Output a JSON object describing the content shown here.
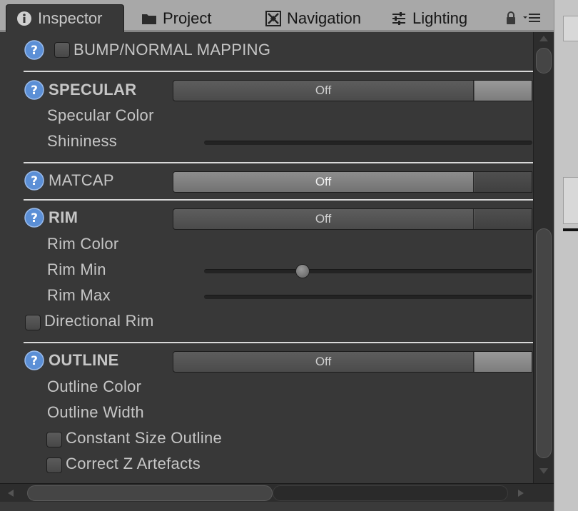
{
  "tabs": [
    {
      "label": "Inspector",
      "icon": "info-icon",
      "active": true
    },
    {
      "label": "Project",
      "icon": "folder-icon"
    },
    {
      "label": "Navigation",
      "icon": "navigation-icon"
    },
    {
      "label": "Lighting",
      "icon": "sliders-icon"
    }
  ],
  "tab_tools": {
    "lock_icon": "lock-icon",
    "menu_icon": "context-menu-icon"
  },
  "inspector": {
    "bump_section": {
      "label": "BUMP/NORMAL MAPPING",
      "checked": false
    },
    "specular_section": {
      "title": "SPECULAR",
      "toggle_value": "Off",
      "specular_color_label": "Specular Color",
      "shininess_label": "Shininess"
    },
    "matcap_section": {
      "title": "MATCAP",
      "toggle_value": "Off"
    },
    "rim_section": {
      "title": "RIM",
      "toggle_value": "Off",
      "rim_color_label": "Rim Color",
      "rim_min_label": "Rim Min",
      "rim_min_value_fraction": 0.3,
      "rim_max_label": "Rim Max",
      "directional_rim_label": "Directional Rim",
      "directional_rim_checked": false
    },
    "outline_section": {
      "title": "OUTLINE",
      "toggle_value": "Off",
      "outline_color_label": "Outline Color",
      "outline_width_label": "Outline Width",
      "constant_size_label": "Constant Size Outline",
      "constant_size_checked": false,
      "correct_z_label": "Correct Z Artefacts",
      "correct_z_checked": false
    }
  },
  "colors": {
    "panel_bg": "#383838",
    "separator": "#d8d8d8",
    "help_icon": "#5b8fd6"
  }
}
